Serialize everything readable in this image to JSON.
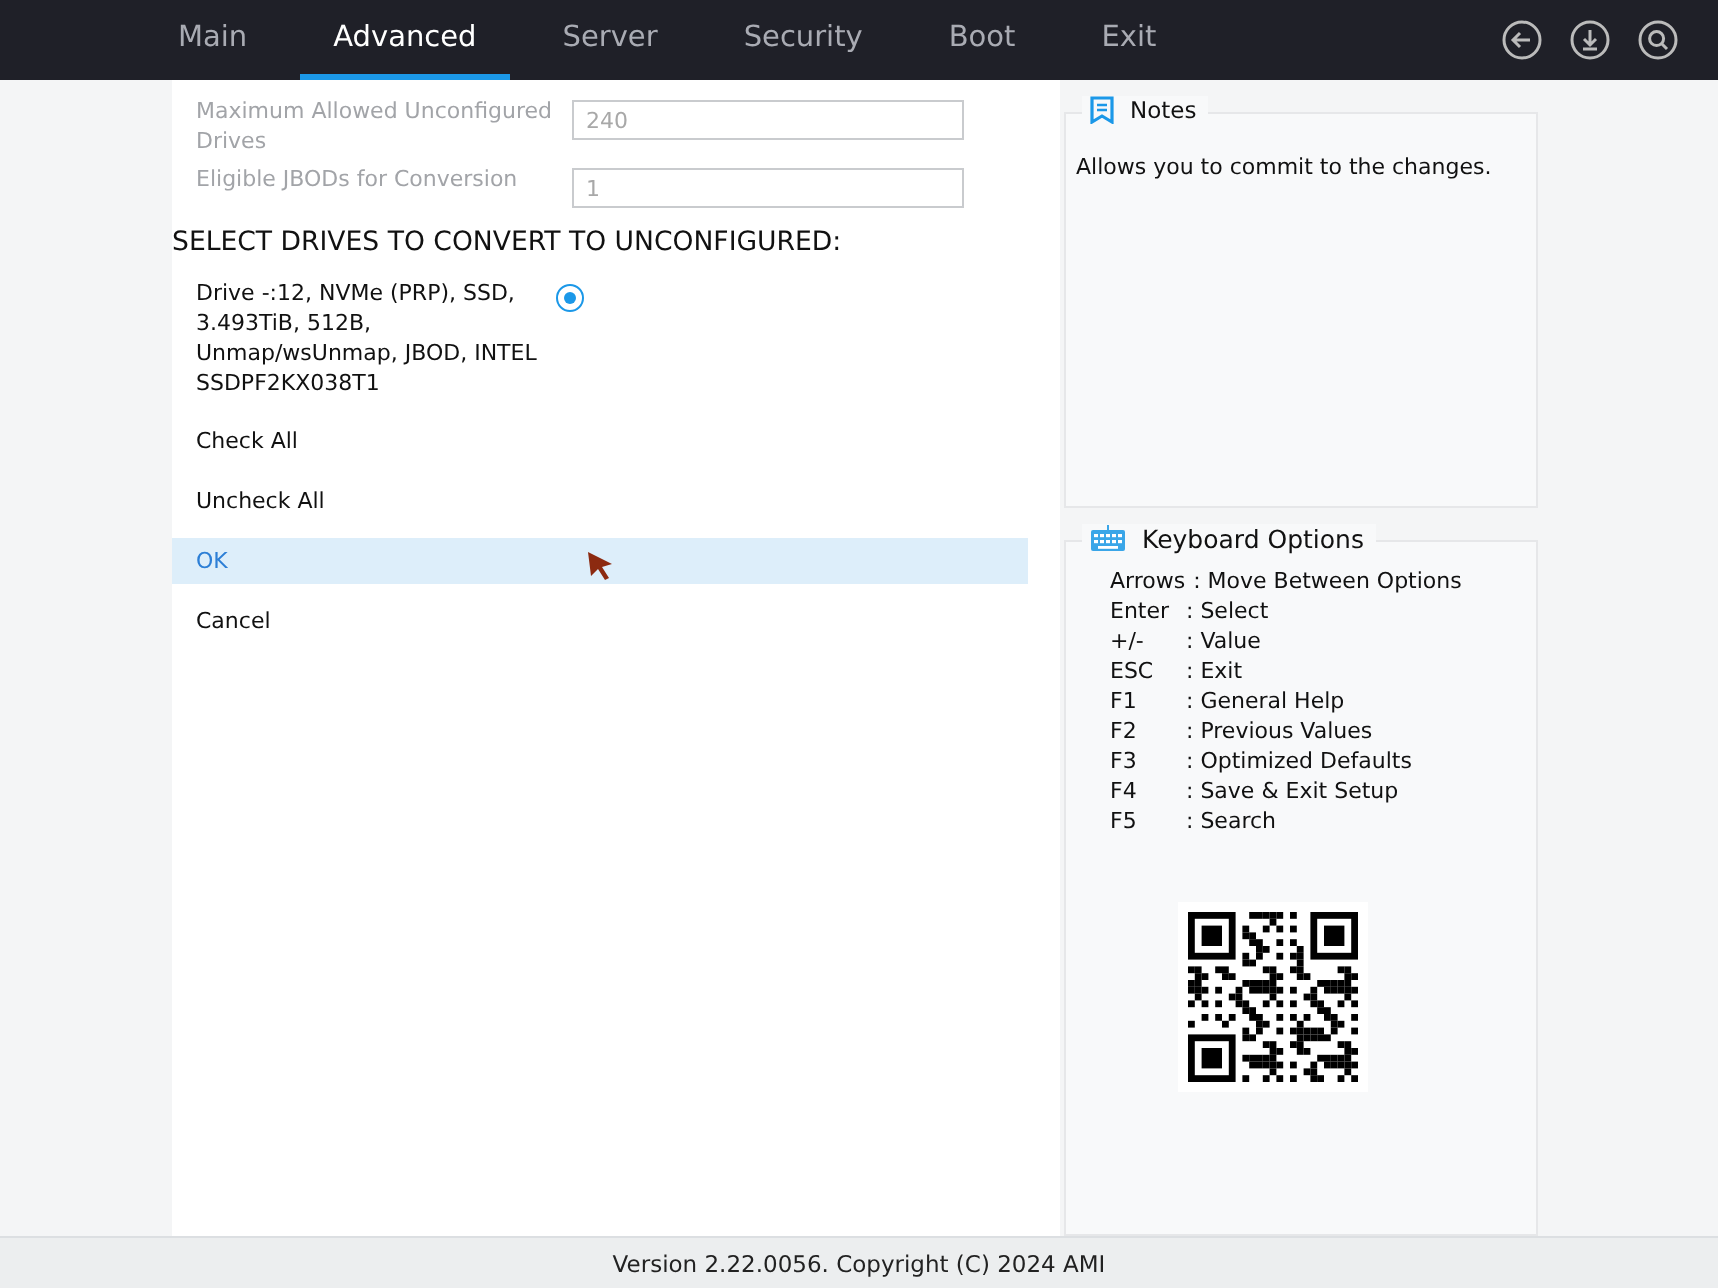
{
  "tabs": [
    {
      "label": "Main",
      "selected": false
    },
    {
      "label": "Advanced",
      "selected": true
    },
    {
      "label": "Server",
      "selected": false
    },
    {
      "label": "Security",
      "selected": false
    },
    {
      "label": "Boot",
      "selected": false
    },
    {
      "label": "Exit",
      "selected": false
    }
  ],
  "settings": [
    {
      "label": "Maximum Allowed Unconfigured Drives",
      "value": "240",
      "disabled": true
    },
    {
      "label": "Eligible JBODs for Conversion",
      "value": "1",
      "disabled": true
    }
  ],
  "section_title": "SELECT DRIVES TO CONVERT TO UNCONFIGURED:",
  "drives": [
    {
      "label": "Drive -:12, NVMe (PRP), SSD, 3.493TiB, 512B, Unmap/wsUnmap, JBOD, INTEL SSDPF2KX038T1",
      "selected": true
    }
  ],
  "actions": [
    {
      "label": "Check All",
      "selected": false
    },
    {
      "label": "Uncheck All",
      "selected": false
    },
    {
      "label": "OK",
      "selected": true
    },
    {
      "label": "Cancel",
      "selected": false
    }
  ],
  "notes": {
    "title": "Notes",
    "text": "Allows you to commit to the changes."
  },
  "keyboard_options": {
    "title": "Keyboard Options",
    "items": [
      {
        "key": "Arrows",
        "action": ": Move Between Options"
      },
      {
        "key": "Enter",
        "action": ": Select"
      },
      {
        "key": "+/-",
        "action": ": Value"
      },
      {
        "key": "ESC",
        "action": ": Exit"
      },
      {
        "key": "F1",
        "action": ": General Help"
      },
      {
        "key": "F2",
        "action": ": Previous Values"
      },
      {
        "key": "F3",
        "action": ": Optimized Defaults"
      },
      {
        "key": "F4",
        "action": ": Save & Exit Setup"
      },
      {
        "key": "F5",
        "action": ": Search"
      }
    ]
  },
  "status_bar": "Version 2.22.0056. Copyright (C) 2024 AMI"
}
